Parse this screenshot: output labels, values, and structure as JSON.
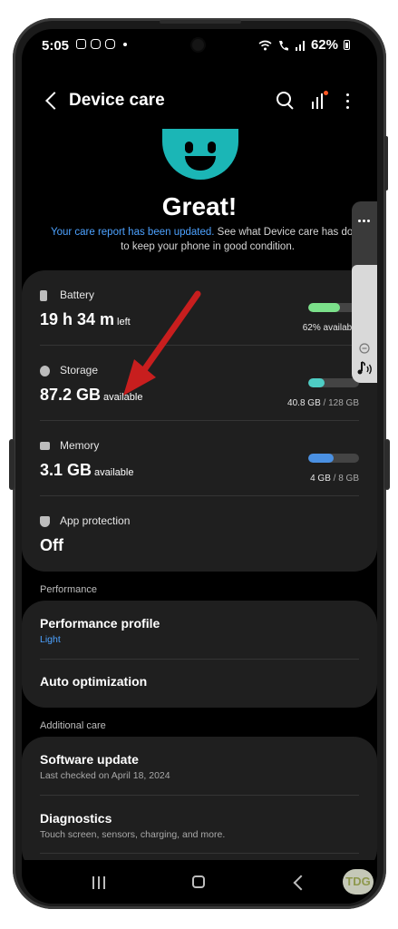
{
  "status_bar": {
    "time": "5:05",
    "battery_percent": "62%"
  },
  "app_bar": {
    "title": "Device care"
  },
  "hero": {
    "headline": "Great!",
    "link_text": "Your care report has been updated.",
    "description_line1": " See what Device care has done",
    "description_line2": "to keep your phone in good condition."
  },
  "status_card": {
    "battery": {
      "label": "Battery",
      "value": "19 h 34 m",
      "suffix": "left",
      "bar_fraction": 0.62,
      "caption": "62% available",
      "bar_color": "#7be08a"
    },
    "storage": {
      "label": "Storage",
      "value": "87.2 GB",
      "suffix": "available",
      "bar_fraction": 0.32,
      "used": "40.8 GB",
      "total": " / 128 GB",
      "bar_color": "#4ecdc4"
    },
    "memory": {
      "label": "Memory",
      "value": "3.1 GB",
      "suffix": "available",
      "bar_fraction": 0.5,
      "used": "4 GB",
      "total": " / 8 GB",
      "bar_color": "#4a90e2"
    },
    "app_protection": {
      "label": "App protection",
      "value": "Off"
    }
  },
  "performance": {
    "section_title": "Performance",
    "profile_title": "Performance profile",
    "profile_value": "Light",
    "auto_optimization": "Auto optimization"
  },
  "additional_care": {
    "section_title": "Additional care",
    "software_update_title": "Software update",
    "software_update_sub": "Last checked on April 18, 2024",
    "diagnostics_title": "Diagnostics",
    "diagnostics_sub": "Touch screen, sensors, charging, and more."
  },
  "watermark": "TDG"
}
